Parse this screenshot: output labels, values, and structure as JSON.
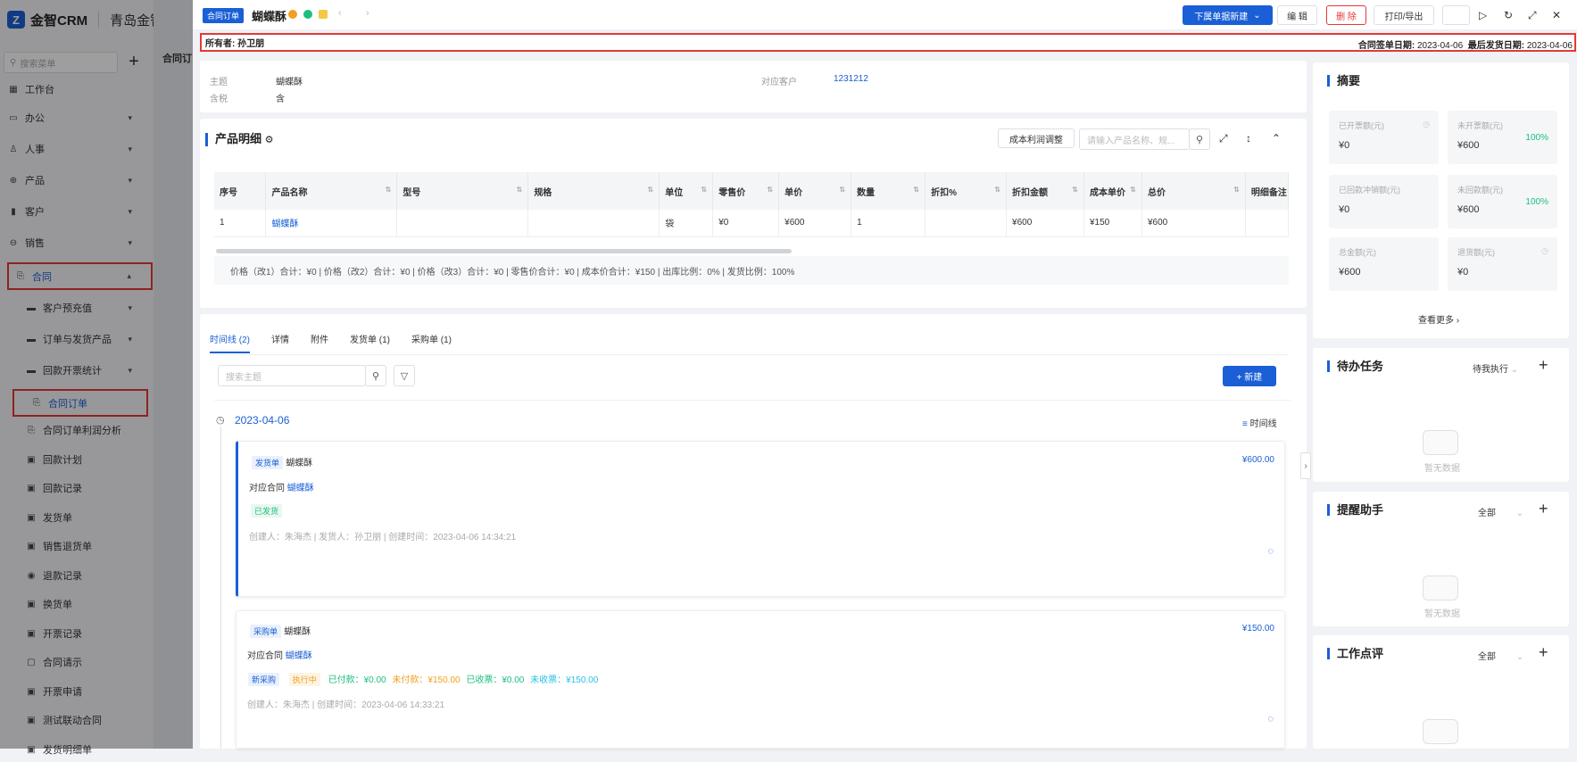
{
  "app": {
    "brand": "金智CRM",
    "company": "青岛金智公司"
  },
  "sidebar": {
    "search_placeholder": "搜索菜单",
    "items": [
      {
        "label": "工作台",
        "icon": "dashboard-icon"
      },
      {
        "label": "办公",
        "icon": "office-icon"
      },
      {
        "label": "人事",
        "icon": "people-icon"
      },
      {
        "label": "产品",
        "icon": "product-icon"
      },
      {
        "label": "客户",
        "icon": "customer-icon"
      },
      {
        "label": "销售",
        "icon": "sales-icon"
      },
      {
        "label": "合同",
        "icon": "contract-icon"
      }
    ],
    "sub_items": [
      {
        "label": "客户预充值"
      },
      {
        "label": "订单与发货产品"
      },
      {
        "label": "回款开票统计"
      },
      {
        "label": "合同订单"
      },
      {
        "label": "合同订单利润分析"
      },
      {
        "label": "回款计划"
      },
      {
        "label": "回款记录"
      },
      {
        "label": "发货单"
      },
      {
        "label": "销售退货单"
      },
      {
        "label": "退款记录"
      },
      {
        "label": "换货单"
      },
      {
        "label": "开票记录"
      },
      {
        "label": "合同请示"
      },
      {
        "label": "开票申请"
      },
      {
        "label": "测试联动合同"
      },
      {
        "label": "发货明细单"
      }
    ],
    "bg_label": "合同订"
  },
  "topbar": {
    "badge": "合同订单",
    "title": "蝴蝶酥",
    "btn_new_sub": "下属单据新建",
    "btn_edit": "编 辑",
    "btn_delete": "删 除",
    "btn_print": "打印/导出"
  },
  "owner_bar": {
    "owner_label": "所有者:",
    "owner": "孙卫朋",
    "sign_label": "合同签单日期:",
    "sign_date": "2023-04-06",
    "ship_label": "最后发货日期:",
    "ship_date": "2023-04-06"
  },
  "info": {
    "subject_label": "主题",
    "subject": "蝴蝶酥",
    "tax_label": "含税",
    "tax": "含",
    "customer_label": "对应客户",
    "customer": "1231212"
  },
  "products": {
    "title": "产品明细",
    "cost_btn": "成本利润调整",
    "search_placeholder": "请输入产品名称、规...",
    "headers": [
      "序号",
      "产品名称",
      "型号",
      "规格",
      "单位",
      "零售价",
      "单价",
      "数量",
      "折扣%",
      "折扣金额",
      "成本单价",
      "总价",
      "明细备注"
    ],
    "rows": [
      [
        "1",
        "蝴蝶酥",
        "",
        "",
        "袋",
        "¥0",
        "¥600",
        "1",
        "",
        "¥600",
        "¥150",
        "¥600",
        ""
      ]
    ],
    "summary": "价格（改1）合计：¥0 |   价格（改2）合计：¥0 |   价格（改3）合计：¥0 |   零售价合计：¥0 |   成本价合计：¥150 |   出库比例：0% |   发货比例：100%"
  },
  "tabs": [
    {
      "label": "时间线 (2)"
    },
    {
      "label": "详情"
    },
    {
      "label": "附件"
    },
    {
      "label": "发货单 (1)"
    },
    {
      "label": "采购单 (1)"
    }
  ],
  "timeline": {
    "search_placeholder": "搜索主题",
    "new_btn": "+ 新建",
    "date": "2023-04-06",
    "view_label": "时间线",
    "cards": [
      {
        "type": "发货单",
        "name": "蝴蝶酥",
        "amount": "¥600.00",
        "contract_label": "对应合同",
        "contract": "蝴蝶酥",
        "status": "已发货",
        "meta": "创建人：朱海杰  |  发货人：孙卫朋  |  创建时间：2023-04-06 14:34:21"
      },
      {
        "type": "采购单",
        "name": "蝴蝶酥",
        "amount": "¥150.00",
        "contract_label": "对应合同",
        "contract": "蝴蝶酥",
        "tag1": "新采购",
        "tag2": "执行中",
        "paid": "已付款：¥0.00",
        "unpaid": "未付款：¥150.00",
        "received": "已收票：¥0.00",
        "unreceived": "未收票：¥150.00",
        "meta": "创建人：朱海杰  |  创建时间：2023-04-06 14:33:21"
      }
    ]
  },
  "summary_card": {
    "title": "摘要",
    "stats": [
      {
        "label": "已开票额(元)",
        "value": "¥0",
        "pct": ""
      },
      {
        "label": "未开票额(元)",
        "value": "¥600",
        "pct": "100%"
      },
      {
        "label": "已回款冲销额(元)",
        "value": "¥0",
        "pct": ""
      },
      {
        "label": "未回款额(元)",
        "value": "¥600",
        "pct": "100%"
      },
      {
        "label": "总金额(元)",
        "value": "¥600",
        "pct": ""
      },
      {
        "label": "退货额(元)",
        "value": "¥0",
        "pct": ""
      }
    ],
    "more": "查看更多"
  },
  "todo": {
    "title": "待办任务",
    "filter": "待我执行",
    "empty": "暂无数据"
  },
  "reminder": {
    "title": "提醒助手",
    "filter": "全部",
    "empty": "暂无数据"
  },
  "review": {
    "title": "工作点评",
    "filter": "全部"
  },
  "colors": {
    "primary": "#1a5fd6",
    "danger": "#e53935",
    "success": "#1bbf7d",
    "orange": "#f0a020"
  }
}
